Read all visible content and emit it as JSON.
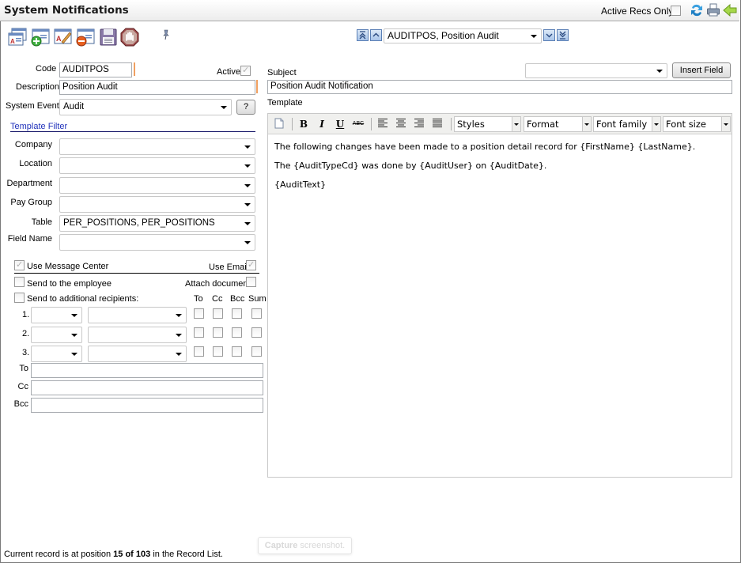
{
  "window": {
    "title": "System Notifications",
    "active_recs_only_label": "Active Recs Only",
    "active_recs_only_checked": false,
    "header_icons": [
      "refresh-icon",
      "print-icon",
      "back-arrow-icon"
    ]
  },
  "toolbar": {
    "icons": [
      "list-records-icon",
      "add-record-icon",
      "edit-record-icon",
      "delete-record-icon",
      "save-icon",
      "stop-icon",
      "pin-icon"
    ],
    "record_selector": {
      "value": "AUDITPOS, Position Audit",
      "nav": [
        "first-record-icon",
        "previous-record-icon",
        "next-record-icon",
        "last-record-icon"
      ]
    }
  },
  "form": {
    "code": {
      "label": "Code",
      "value": "AUDITPOS"
    },
    "active": {
      "label": "Active",
      "checked": true
    },
    "description": {
      "label": "Description",
      "value": "Position Audit"
    },
    "system_event": {
      "label": "System Event",
      "value": "Audit",
      "help_label": "?"
    },
    "template_filter": {
      "title": "Template Filter",
      "fields": [
        {
          "label": "Company",
          "value": ""
        },
        {
          "label": "Location",
          "value": ""
        },
        {
          "label": "Department",
          "value": ""
        },
        {
          "label": "Pay Group",
          "value": ""
        },
        {
          "label": "Table",
          "value": "PER_POSITIONS, PER_POSITIONS"
        },
        {
          "label": "Field Name",
          "value": ""
        }
      ]
    },
    "use_message_center": {
      "label": "Use Message Center",
      "checked": true
    },
    "use_email": {
      "label": "Use Email",
      "checked": true
    },
    "send_to_employee": {
      "label": "Send to the employee",
      "checked": false
    },
    "attach_documents": {
      "label": "Attach documents",
      "checked": false
    },
    "send_to_additional": {
      "label": "Send to additional recipients:",
      "checked": false
    },
    "recipient_columns": [
      "To",
      "Cc",
      "Bcc",
      "Sum"
    ],
    "recipients": [
      {
        "index": "1.",
        "type": "",
        "value": "",
        "to": false,
        "cc": false,
        "bcc": false,
        "sum": false
      },
      {
        "index": "2.",
        "type": "",
        "value": "",
        "to": false,
        "cc": false,
        "bcc": false,
        "sum": false
      },
      {
        "index": "3.",
        "type": "",
        "value": "",
        "to": false,
        "cc": false,
        "bcc": false,
        "sum": false
      }
    ],
    "to": {
      "label": "To",
      "value": ""
    },
    "cc": {
      "label": "Cc",
      "value": ""
    },
    "bcc": {
      "label": "Bcc",
      "value": ""
    }
  },
  "message": {
    "subject_label": "Subject",
    "subject_value": "Position Audit Notification",
    "insert_field_select": "",
    "insert_field_button": "Insert Field",
    "template_label": "Template",
    "editor_toolbar": {
      "buttons": [
        "new-document-icon",
        "bold-icon",
        "italic-icon",
        "underline-icon",
        "strikethrough-icon",
        "align-left-icon",
        "align-center-icon",
        "align-right-icon",
        "align-justify-icon"
      ],
      "styles": "Styles",
      "format": "Format",
      "font_family": "Font family",
      "font_size": "Font size"
    },
    "body": [
      "The following changes have been made to a position detail record for {FirstName} {LastName}.",
      "The {AuditTypeCd} was done by {AuditUser} on {AuditDate}.",
      "{AuditText}"
    ]
  },
  "status": {
    "prefix": "Current record is at position ",
    "position": "15 of 103",
    "suffix": " in the Record List."
  },
  "overlay": {
    "capture_bold": "Capture",
    "capture_rest": " screenshot."
  }
}
